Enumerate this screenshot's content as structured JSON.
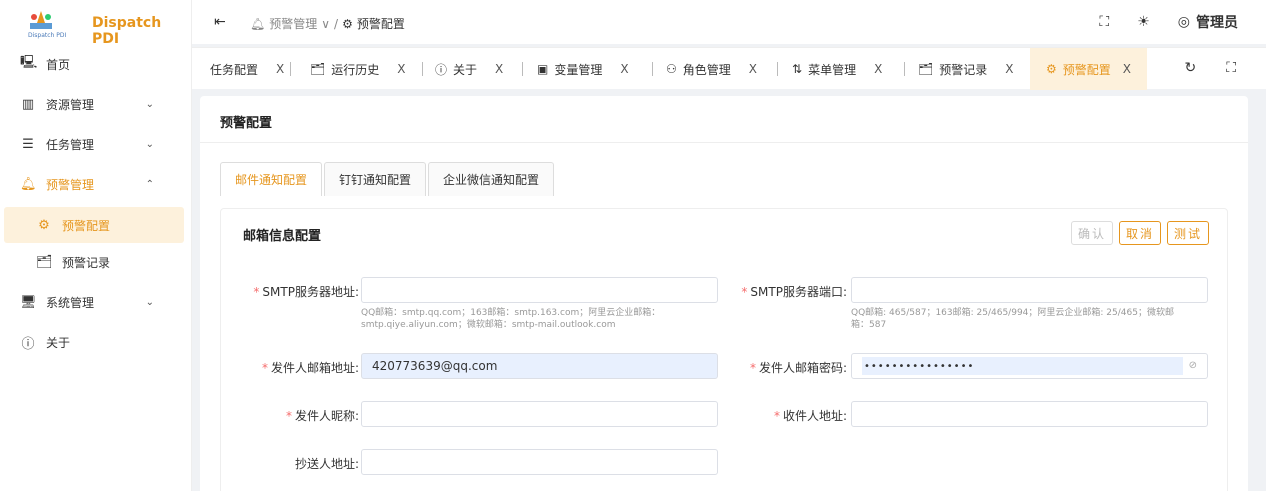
{
  "app": {
    "title": "Dispatch PDI",
    "logo_sub": "Dispatch PDI"
  },
  "sidebar": {
    "items": [
      {
        "label": "首页",
        "icon": "monitor-icon"
      },
      {
        "label": "资源管理",
        "icon": "library-icon"
      },
      {
        "label": "任务管理",
        "icon": "list-icon"
      },
      {
        "label": "预警管理",
        "icon": "bell-icon"
      },
      {
        "label": "预警配置",
        "icon": "gear-icon"
      },
      {
        "label": "预警记录",
        "icon": "briefcase-icon"
      },
      {
        "label": "系统管理",
        "icon": "computer-icon"
      },
      {
        "label": "关于",
        "icon": "info-icon"
      }
    ]
  },
  "header": {
    "breadcrumb": [
      "预警管理",
      "预警配置"
    ],
    "user": "管理员"
  },
  "tabs": [
    {
      "label": "任务配置"
    },
    {
      "label": "运行历史"
    },
    {
      "label": "关于"
    },
    {
      "label": "变量管理"
    },
    {
      "label": "角色管理"
    },
    {
      "label": "菜单管理"
    },
    {
      "label": "预警记录"
    },
    {
      "label": "预警配置"
    }
  ],
  "tab_close": "X",
  "page": {
    "title": "预警配置"
  },
  "config_tabs": [
    "邮件通知配置",
    "钉钉通知配置",
    "企业微信通知配置"
  ],
  "card": {
    "title": "邮箱信息配置",
    "confirm": "确认",
    "cancel": "取消",
    "test": "测试"
  },
  "form": {
    "smtp_host": {
      "label": "SMTP服务器地址:",
      "value": "",
      "help1": "QQ邮箱：smtp.qq.com；163邮箱：smtp.163.com；阿里云企业邮箱：",
      "help2": "smtp.qiye.aliyun.com；微软邮箱：smtp-mail.outlook.com"
    },
    "smtp_port": {
      "label": "SMTP服务器端口:",
      "value": "",
      "help1": "QQ邮箱: 465/587；163邮箱: 25/465/994；阿里云企业邮箱: 25/465；微软邮",
      "help2": "箱：587"
    },
    "sender_email": {
      "label": "发件人邮箱地址:",
      "value": "420773639@qq.com"
    },
    "sender_password": {
      "label": "发件人邮箱密码:",
      "value": "••••••••••••••••"
    },
    "sender_name": {
      "label": "发件人昵称:",
      "value": ""
    },
    "recipient": {
      "label": "收件人地址:",
      "value": ""
    },
    "cc": {
      "label": "抄送人地址:",
      "value": ""
    }
  },
  "colors": {
    "accent": "#e6961e",
    "required": "#f56c6c"
  }
}
